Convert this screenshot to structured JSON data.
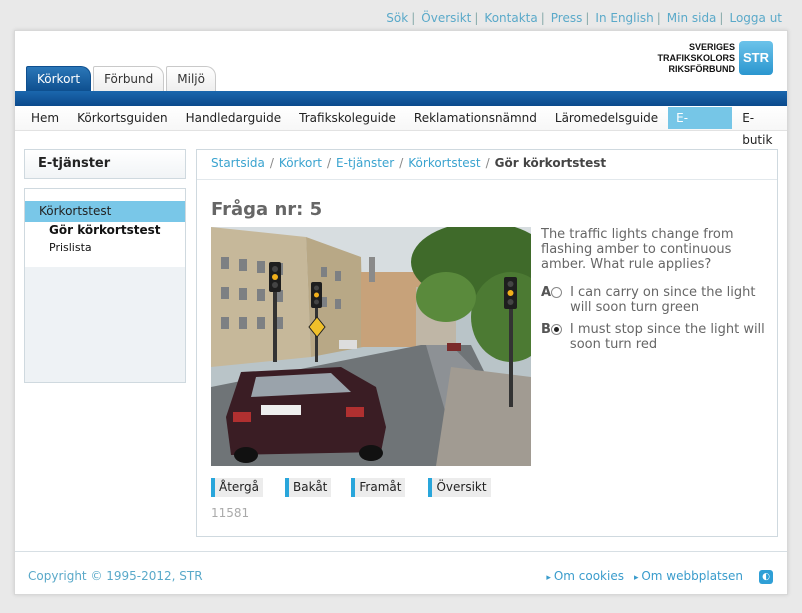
{
  "utility_links": [
    "Sök",
    "Översikt",
    "Kontakta",
    "Press",
    "In English",
    "Min sida",
    "Logga ut"
  ],
  "tabs": [
    {
      "label": "Körkort",
      "active": true
    },
    {
      "label": "Förbund",
      "active": false
    },
    {
      "label": "Miljö",
      "active": false
    }
  ],
  "logo": {
    "line1": "SVERIGES",
    "line2": "TRAFIKSKOLORS",
    "line3": "RIKSFÖRBUND",
    "badge": "STR"
  },
  "main_nav": [
    {
      "label": "Hem",
      "active": false
    },
    {
      "label": "Körkortsguiden",
      "active": false
    },
    {
      "label": "Handledarguide",
      "active": false
    },
    {
      "label": "Trafikskoleguide",
      "active": false
    },
    {
      "label": "Reklamationsnämnd",
      "active": false
    },
    {
      "label": "Läromedelsguide",
      "active": false
    },
    {
      "label": "E-tjänster",
      "active": true
    },
    {
      "label": "E-butik",
      "active": false
    }
  ],
  "sidebar": {
    "title": "E-tjänster",
    "item": "Körkortstest",
    "sub_items": [
      "Gör körkortstest",
      "Prislista"
    ]
  },
  "breadcrumb": {
    "links": [
      "Startsida",
      "Körkort",
      "E-tjänster",
      "Körkortstest"
    ],
    "current": "Gör körkortstest"
  },
  "question": {
    "title": "Fråga nr: 5",
    "text": "The traffic lights change from flashing amber to continuous amber. What rule applies?",
    "answers": [
      {
        "letter": "A",
        "text": "I can carry on since the light will soon turn green",
        "selected": false
      },
      {
        "letter": "B",
        "text": "I must stop since the light will soon turn red",
        "selected": true
      }
    ],
    "id": "11581"
  },
  "buttons": [
    "Återgå",
    "Bakåt",
    "Framåt",
    "Översikt"
  ],
  "footer": {
    "copyright": "Copyright © 1995-2012, STR",
    "links": [
      "Om cookies",
      "Om webbplatsen"
    ]
  },
  "colors": {
    "brand_blue": "#0e4f8f",
    "accent_cyan": "#76c6e7",
    "link_blue": "#3aa3cf"
  }
}
